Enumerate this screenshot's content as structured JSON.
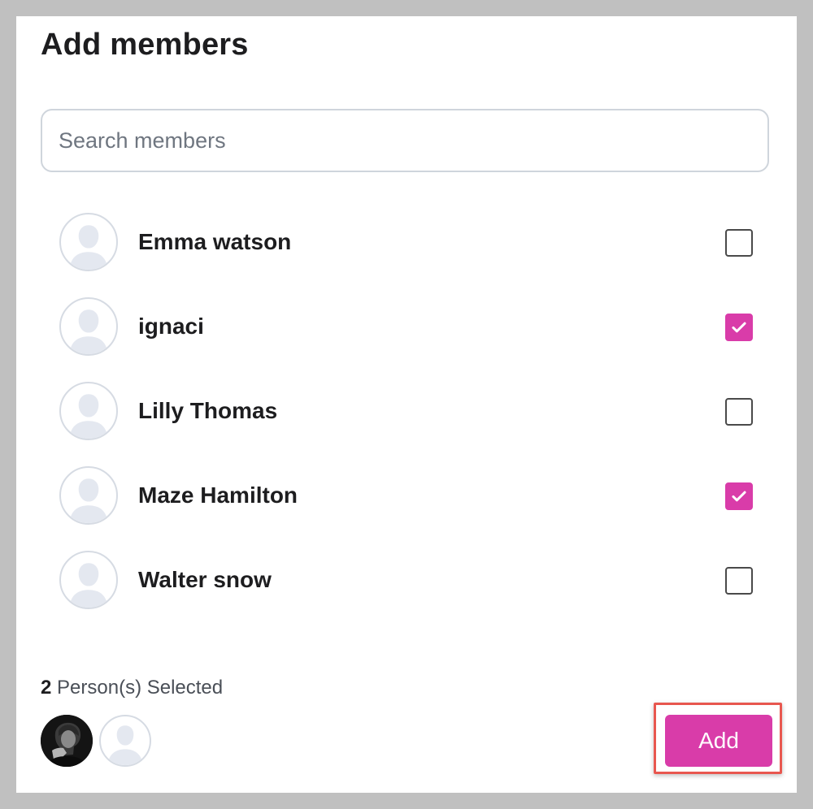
{
  "dialog": {
    "title": "Add members"
  },
  "search": {
    "placeholder": "Search members",
    "value": ""
  },
  "members": [
    {
      "name": "Emma watson",
      "selected": false,
      "avatar": "person-placeholder-icon"
    },
    {
      "name": "ignaci",
      "selected": true,
      "avatar": "person-placeholder-icon"
    },
    {
      "name": "Lilly Thomas",
      "selected": false,
      "avatar": "person-placeholder-icon"
    },
    {
      "name": "Maze Hamilton",
      "selected": true,
      "avatar": "person-placeholder-icon"
    },
    {
      "name": "Walter snow",
      "selected": false,
      "avatar": "person-placeholder-icon"
    }
  ],
  "selection": {
    "count": "2",
    "label": "Person(s) Selected",
    "avatars": [
      "photo",
      "person-placeholder-icon"
    ]
  },
  "actions": {
    "add_label": "Add"
  },
  "colors": {
    "accent": "#d93ca9",
    "highlight_border": "#e8574f",
    "frame_background": "#c0c0c0"
  }
}
